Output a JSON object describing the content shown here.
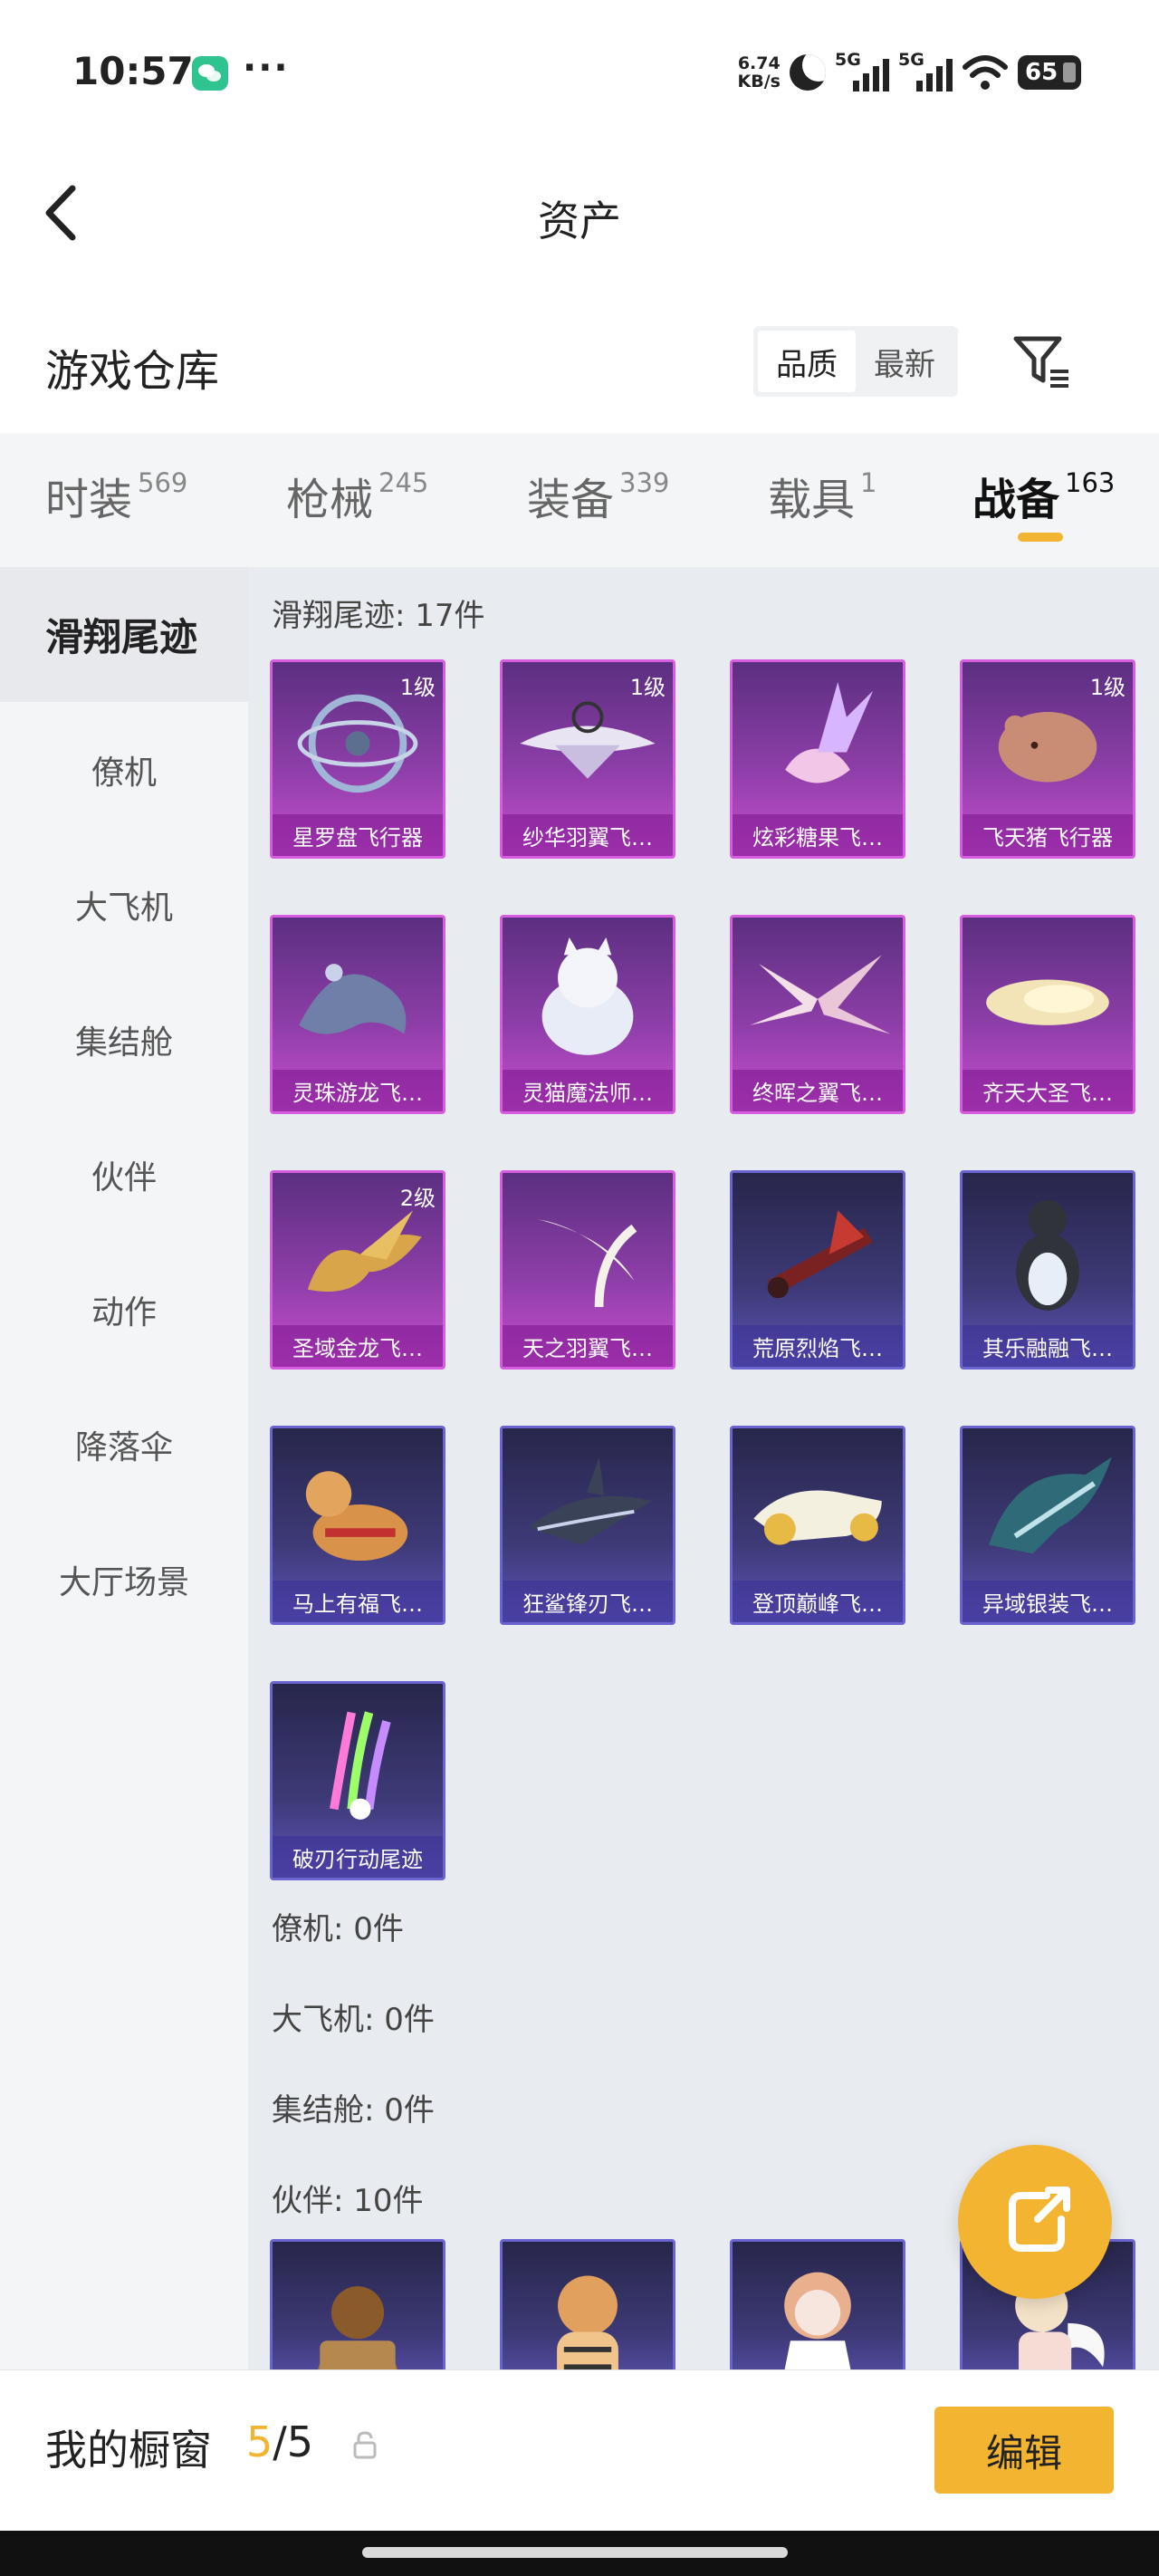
{
  "status_bar": {
    "time": "10:57",
    "more": "···",
    "net_speed_value": "6.74",
    "net_speed_unit": "KB/s",
    "signal_1": "5G",
    "signal_2": "5G",
    "battery": "65"
  },
  "header": {
    "title": "资产"
  },
  "warehouse": {
    "title": "游戏仓库",
    "sort_options": [
      "品质",
      "最新"
    ],
    "active_sort": "品质"
  },
  "tabs": [
    {
      "name": "时装",
      "count": "569"
    },
    {
      "name": "枪械",
      "count": "245"
    },
    {
      "name": "装备",
      "count": "339"
    },
    {
      "name": "载具",
      "count": "1"
    },
    {
      "name": "战备",
      "count": "163"
    }
  ],
  "active_tab": "战备",
  "sidebar": {
    "items": [
      "滑翔尾迹",
      "僚机",
      "大飞机",
      "集结舱",
      "伙伴",
      "动作",
      "降落伞",
      "大厅场景"
    ],
    "active": "滑翔尾迹"
  },
  "sections": {
    "glide": "滑翔尾迹: 17件",
    "wingman": "僚机: 0件",
    "plane": "大飞机: 0件",
    "pod": "集结舱: 0件",
    "partner": "伙伴: 10件"
  },
  "glide_items": [
    {
      "name": "星罗盘飞行器",
      "level": "1级",
      "rarity": "purple"
    },
    {
      "name": "纱华羽翼飞…",
      "level": "1级",
      "rarity": "purple"
    },
    {
      "name": "炫彩糖果飞…",
      "level": "",
      "rarity": "purple"
    },
    {
      "name": "飞天猪飞行器",
      "level": "1级",
      "rarity": "purple"
    },
    {
      "name": "灵珠游龙飞…",
      "level": "",
      "rarity": "purple"
    },
    {
      "name": "灵猫魔法师…",
      "level": "",
      "rarity": "purple"
    },
    {
      "name": "终晖之翼飞…",
      "level": "",
      "rarity": "purple"
    },
    {
      "name": "齐天大圣飞…",
      "level": "",
      "rarity": "purple"
    },
    {
      "name": "圣域金龙飞…",
      "level": "2级",
      "rarity": "purple"
    },
    {
      "name": "天之羽翼飞…",
      "level": "",
      "rarity": "purple"
    },
    {
      "name": "荒原烈焰飞…",
      "level": "",
      "rarity": "blue"
    },
    {
      "name": "其乐融融飞…",
      "level": "",
      "rarity": "blue"
    },
    {
      "name": "马上有福飞…",
      "level": "",
      "rarity": "blue"
    },
    {
      "name": "狂鲨锋刃飞…",
      "level": "",
      "rarity": "blue"
    },
    {
      "name": "登顶巅峰飞…",
      "level": "",
      "rarity": "blue"
    },
    {
      "name": "异域银装飞…",
      "level": "",
      "rarity": "blue"
    },
    {
      "name": "破刃行动尾迹",
      "level": "",
      "rarity": "blue"
    }
  ],
  "bottom": {
    "showcase_title": "我的橱窗",
    "showcase_current": "5",
    "showcase_sep": "/",
    "showcase_total": "5",
    "edit_label": "编辑"
  },
  "colors": {
    "accent": "#f2b431",
    "purple_card": "#8d3ea8",
    "blue_card": "#3e3a78"
  }
}
